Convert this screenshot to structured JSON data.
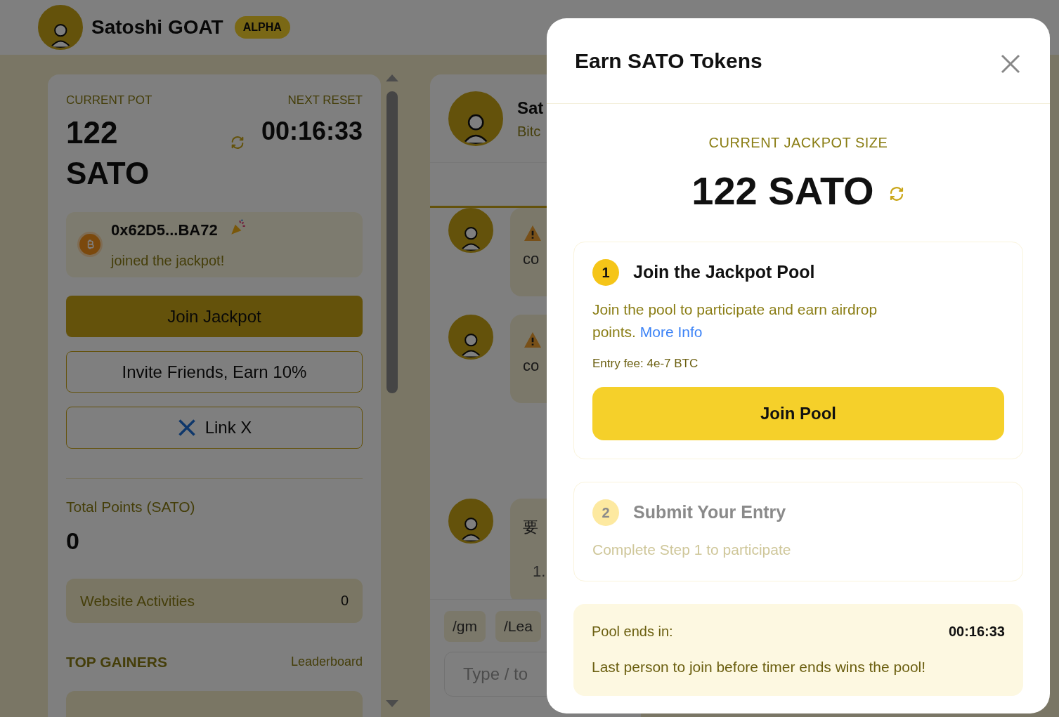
{
  "header": {
    "title": "Satoshi GOAT",
    "badge": "ALPHA"
  },
  "pot": {
    "label": "CURRENT POT",
    "value": "122 SATO",
    "reset_label": "NEXT RESET",
    "reset_value": "00:16:33"
  },
  "activity": {
    "address": "0x62D5...BA72",
    "message": "joined the jackpot!"
  },
  "buttons": [
    {
      "label": "Join Jackpot",
      "kind": "primary"
    },
    {
      "label": "Invite Friends, Earn 10%",
      "kind": "outline"
    },
    {
      "label": "Link X",
      "kind": "x"
    }
  ],
  "points": {
    "label": "Total Points (SATO)",
    "value": "0",
    "rows": [
      {
        "label": "Website Activities",
        "value": "0"
      }
    ]
  },
  "top_gainers": {
    "title": "TOP GAINERS",
    "link": "Leaderboard"
  },
  "chat": {
    "name": "Sat",
    "subtitle": "Bitc",
    "messages": [
      {
        "kind": "warning",
        "text": "co"
      },
      {
        "kind": "warning",
        "text": "co"
      },
      {
        "kind": "text",
        "text": "要",
        "list_item": "1."
      }
    ],
    "commands": [
      "/gm",
      "/Lea"
    ],
    "input": {
      "placeholder": "Type / to"
    }
  },
  "modal": {
    "title": "Earn SATO Tokens",
    "jackpot_label": "CURRENT JACKPOT SIZE",
    "jackpot_value": "122 SATO",
    "steps": [
      {
        "number": "1",
        "title": "Join the Jackpot Pool",
        "description": "Join the pool to participate and earn airdrop points.",
        "link": "More Info",
        "fee": "Entry fee: 4e-7 BTC",
        "button": "Join Pool",
        "disabled": false
      },
      {
        "number": "2",
        "title": "Submit Your Entry",
        "description": "Complete Step 1 to participate",
        "disabled": true
      }
    ],
    "timer": {
      "label": "Pool ends in:",
      "value": "00:16:33",
      "note": "Last person to join before timer ends wins the pool!"
    }
  }
}
